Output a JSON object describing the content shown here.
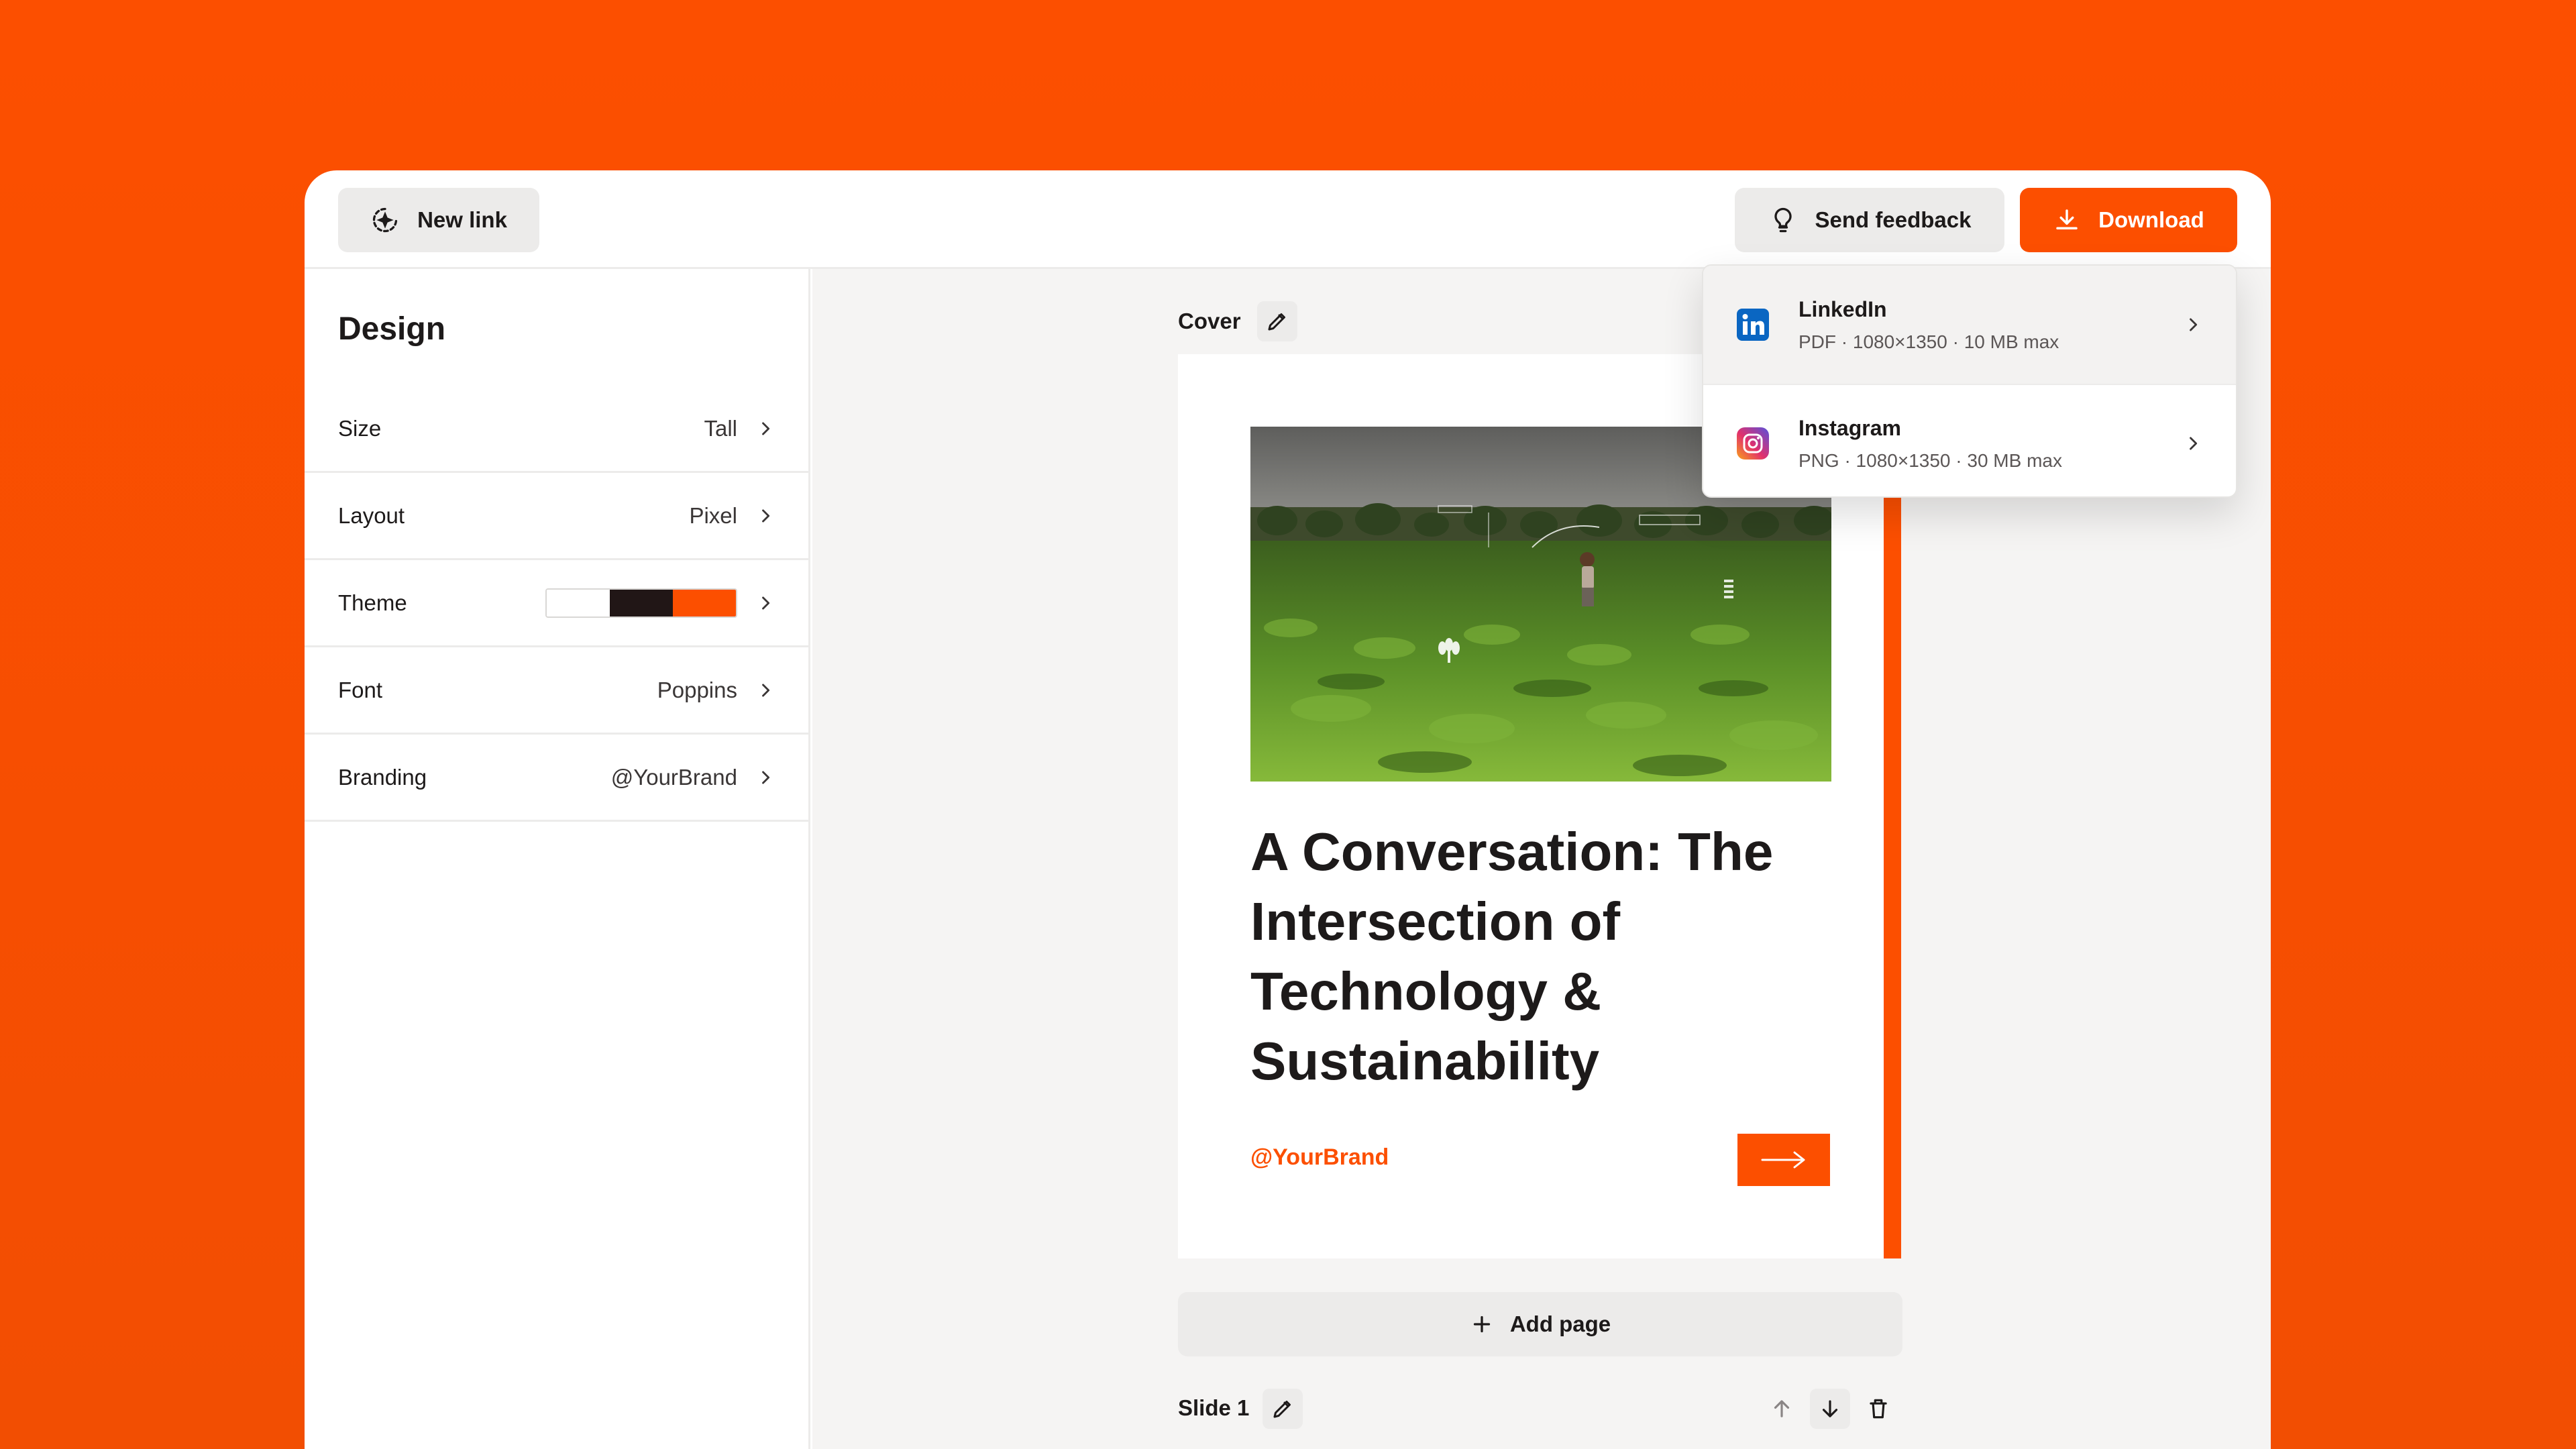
{
  "toolbar": {
    "new_link_label": "New link",
    "send_feedback_label": "Send feedback",
    "download_label": "Download"
  },
  "sidebar": {
    "title": "Design",
    "settings": [
      {
        "label": "Size",
        "value": "Tall"
      },
      {
        "label": "Layout",
        "value": "Pixel"
      },
      {
        "label": "Theme",
        "value": ""
      },
      {
        "label": "Font",
        "value": "Poppins"
      },
      {
        "label": "Branding",
        "value": "@YourBrand"
      }
    ],
    "theme_colors": [
      "#ffffff",
      "#211616",
      "#fc4f00"
    ]
  },
  "canvas": {
    "cover_label": "Cover",
    "card": {
      "title": "A Conversation: The Intersection of Technology & Sustainability",
      "brand": "@YourBrand"
    },
    "add_page_label": "Add page",
    "slide_label": "Slide 1"
  },
  "download_menu": [
    {
      "name": "LinkedIn",
      "meta": "PDF · 1080×1350 · 10 MB max"
    },
    {
      "name": "Instagram",
      "meta": "PNG · 1080×1350 · 30 MB max"
    }
  ],
  "colors": {
    "accent": "#fc4f00",
    "dark": "#1d1a1a",
    "panel": "#ecebea",
    "linkedin": "#0a66c2"
  }
}
